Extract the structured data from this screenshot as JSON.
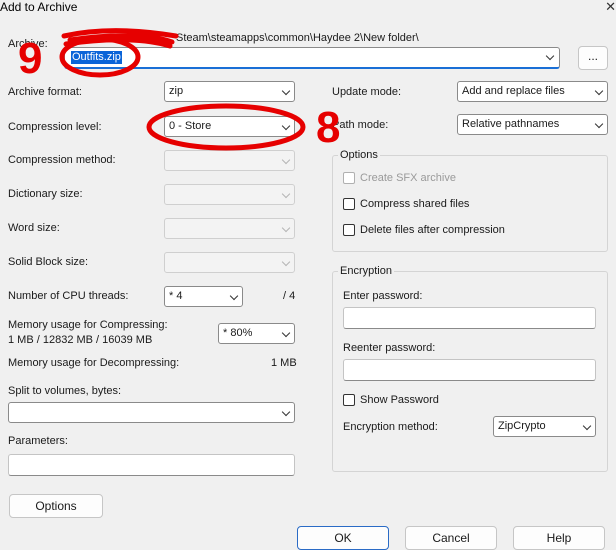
{
  "window": {
    "title": "Add to Archive",
    "close_glyph": "✕"
  },
  "archive": {
    "label": "Archive:",
    "path_suffix": "Steam\\steamapps\\common\\Haydee 2\\New folder\\",
    "filename": "Outfits.zip",
    "browse_label": "..."
  },
  "left": {
    "archive_format_label": "Archive format:",
    "archive_format_value": "zip",
    "compression_level_label": "Compression level:",
    "compression_level_value": "0 - Store",
    "compression_method_label": "Compression method:",
    "dictionary_size_label": "Dictionary size:",
    "word_size_label": "Word size:",
    "solid_block_label": "Solid Block size:",
    "cpu_threads_label": "Number of CPU threads:",
    "cpu_threads_value": "* 4",
    "cpu_threads_max": "/ 4",
    "mem_compress_label": "Memory usage for Compressing:",
    "mem_compress_values": "1 MB / 12832 MB / 16039 MB",
    "mem_compress_select": "* 80%",
    "mem_decompress_label": "Memory usage for Decompressing:",
    "mem_decompress_value": "1 MB",
    "split_label": "Split to volumes, bytes:",
    "split_value": "",
    "params_label": "Parameters:",
    "params_value": ""
  },
  "right": {
    "update_mode_label": "Update mode:",
    "update_mode_value": "Add and replace files",
    "path_mode_label": "Path mode:",
    "path_mode_value": "Relative pathnames",
    "options_group_title": "Options",
    "create_sfx_label": "Create SFX archive",
    "compress_shared_label": "Compress shared files",
    "delete_after_label": "Delete files after compression",
    "encryption_group_title": "Encryption",
    "enter_password_label": "Enter password:",
    "reenter_password_label": "Reenter password:",
    "show_password_label": "Show Password",
    "encryption_method_label": "Encryption method:",
    "encryption_method_value": "ZipCrypto"
  },
  "buttons": {
    "options": "Options",
    "ok": "OK",
    "cancel": "Cancel",
    "help": "Help"
  },
  "annotations": {
    "nine": "9",
    "eight": "8",
    "color": "#e60000"
  }
}
